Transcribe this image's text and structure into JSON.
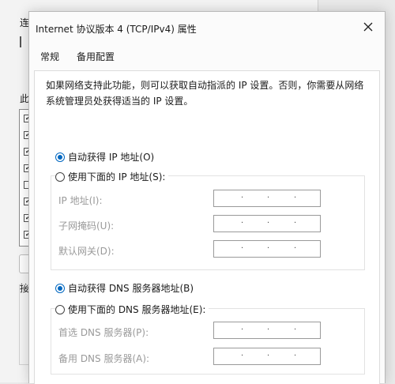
{
  "background_window": {
    "fragment_top": "连",
    "fragment_mid": "此",
    "fragment_low": "接",
    "checkbox_marks": [
      "✔",
      "✔",
      "✔",
      "✔",
      "",
      "✔",
      "✔",
      "✔"
    ]
  },
  "dialog": {
    "title": "Internet 协议版本 4 (TCP/IPv4) 属性",
    "close_glyph": "✕",
    "tabs": [
      {
        "label": "常规",
        "active": true
      },
      {
        "label": "备用配置",
        "active": false
      }
    ],
    "description": "如果网络支持此功能，则可以获取自动指派的 IP 设置。否则，你需要从网络系统管理员处获得适当的 IP 设置。",
    "ip_section": {
      "auto_option": "自动获得 IP 地址(O)",
      "manual_option": "使用下面的 IP 地址(S):",
      "selected": "auto",
      "fields": [
        {
          "label": "IP 地址(I):",
          "value": ". . ."
        },
        {
          "label": "子网掩码(U):",
          "value": ". . ."
        },
        {
          "label": "默认网关(D):",
          "value": ". . ."
        }
      ]
    },
    "dns_section": {
      "auto_option": "自动获得 DNS 服务器地址(B)",
      "manual_option": "使用下面的 DNS 服务器地址(E):",
      "selected": "auto",
      "fields": [
        {
          "label": "首选 DNS 服务器(P):",
          "value": ". . ."
        },
        {
          "label": "备用 DNS 服务器(A):",
          "value": ". . ."
        }
      ]
    },
    "colors": {
      "accent": "#0067c0",
      "disabled_text": "#9a9a9a"
    }
  }
}
